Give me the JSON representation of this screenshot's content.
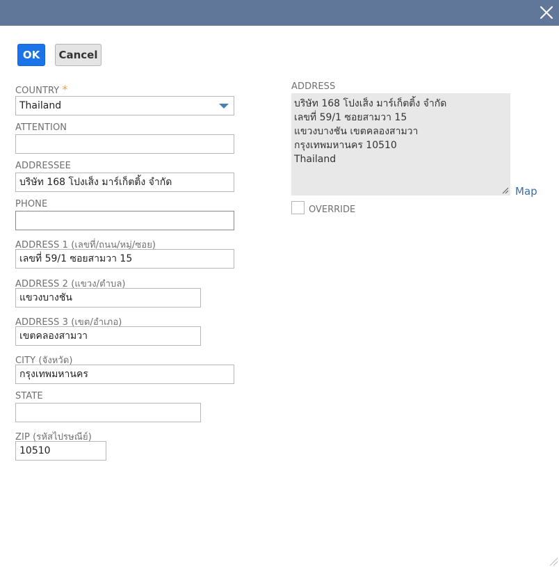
{
  "dialog": {
    "close_icon": "close-icon"
  },
  "buttons": {
    "ok_label": "OK",
    "cancel_label": "Cancel"
  },
  "form": {
    "country": {
      "label": "COUNTRY",
      "required_mark": "*",
      "value": "Thailand"
    },
    "attention": {
      "label": "ATTENTION",
      "value": ""
    },
    "addressee": {
      "label": "ADDRESSEE",
      "value": "บริษัท 168 โปงเส็ง มาร์เก็ตติ้ง จำกัด"
    },
    "phone": {
      "label": "PHONE",
      "value": ""
    },
    "address1": {
      "label": "ADDRESS 1 (เลขที่/ถนน/หมู่/ซอย)",
      "value": "เลขที่ 59/1 ซอยสามวา 15"
    },
    "address2": {
      "label": "ADDRESS 2 (แขวง/ตำบล)",
      "value": "แขวงบางชัน"
    },
    "address3": {
      "label": "ADDRESS 3 (เขต/อำเภอ)",
      "value": "เขตคลองสามวา"
    },
    "city": {
      "label": "CITY (จังหวัด)",
      "value": "กรุงเทพมหานคร"
    },
    "state": {
      "label": "STATE",
      "value": ""
    },
    "zip": {
      "label": "ZIP (รหัสไปรษณีย์)",
      "value": "10510"
    }
  },
  "address_panel": {
    "label": "ADDRESS",
    "lines": [
      "บริษัท 168 โปงเส็ง มาร์เก็ตติ้ง จำกัด",
      "เลขที่ 59/1 ซอยสามวา 15",
      "แขวงบางชัน  เขตคลองสามวา",
      "กรุงเทพมหานคร  10510",
      "Thailand"
    ],
    "map_label": "Map",
    "override_label": "OVERRIDE",
    "override_checked": false
  }
}
